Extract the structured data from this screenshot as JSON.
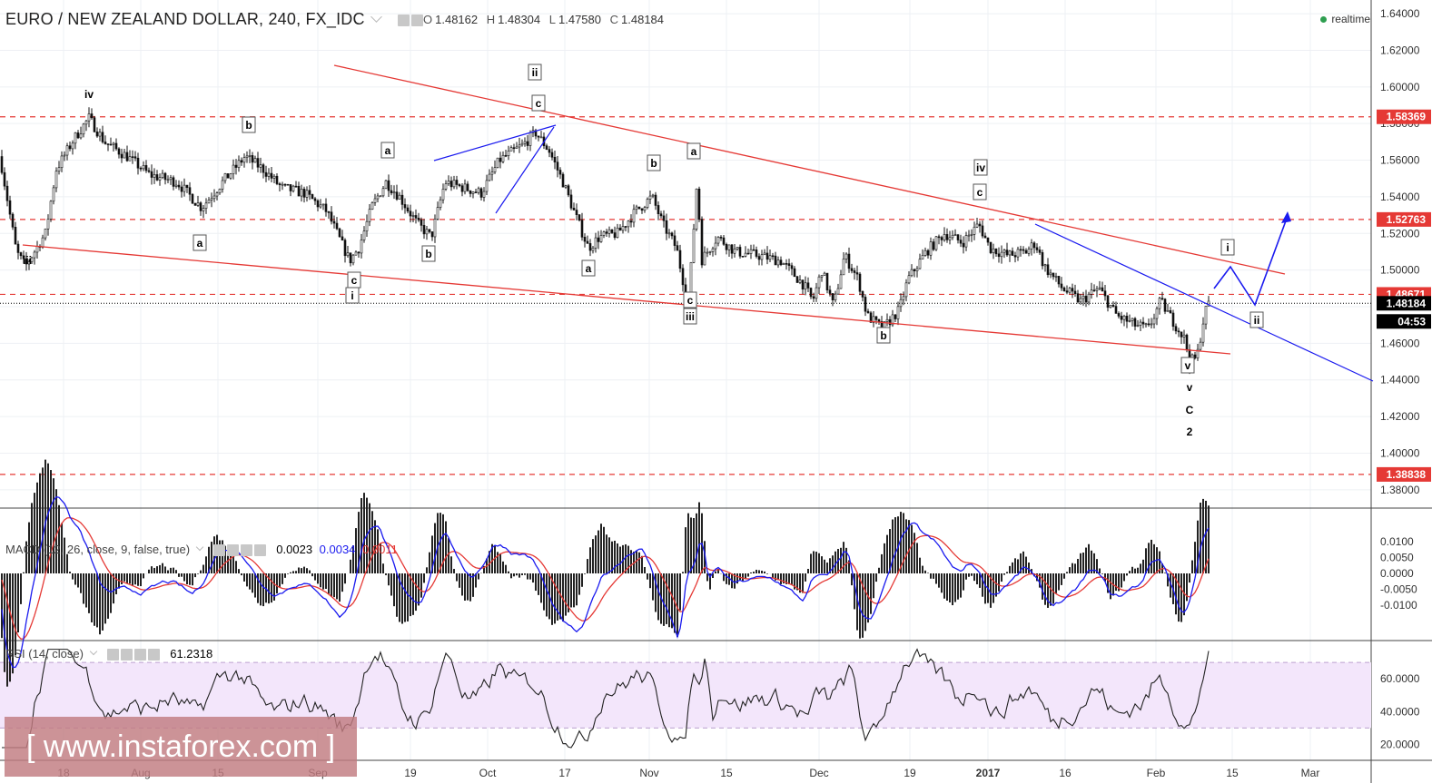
{
  "header": {
    "title": "EURO / NEW ZEALAND DOLLAR, 240, FX_IDC",
    "open_label": "O",
    "open": "1.48162",
    "high_label": "H",
    "high": "1.48304",
    "low_label": "L",
    "low": "1.47580",
    "close_label": "C",
    "close": "1.48184",
    "realtime": "realtime"
  },
  "price_scale": [
    "1.64000",
    "1.62000",
    "1.60000",
    "1.58000",
    "1.56000",
    "1.54000",
    "1.52000",
    "1.50000",
    "1.48000",
    "1.46000",
    "1.44000",
    "1.42000",
    "1.40000",
    "1.38000"
  ],
  "price_tags": [
    {
      "label": "1.58369",
      "kind": "level"
    },
    {
      "label": "1.52763",
      "kind": "level"
    },
    {
      "label": "1.48671",
      "kind": "level"
    },
    {
      "label": "1.48184",
      "kind": "current"
    },
    {
      "label": "04:53",
      "kind": "timer"
    },
    {
      "label": "1.38838",
      "kind": "level"
    }
  ],
  "time_axis": [
    "18",
    "Aug",
    "15",
    "Sep",
    "19",
    "Oct",
    "17",
    "Nov",
    "15",
    "Dec",
    "19",
    "2017",
    "16",
    "Feb",
    "15",
    "Mar"
  ],
  "wave_labels": [
    "iv",
    "iii",
    "b",
    "a",
    "c",
    "i",
    "a",
    "b",
    "ii",
    "c",
    "a",
    "b",
    "a",
    "c",
    "iii",
    "iv",
    "c",
    "b",
    "i",
    "ii",
    "v",
    "v",
    "C",
    "2"
  ],
  "macd": {
    "label": "MACD (12, 26, close, 9, false, true)",
    "hist": "0.0023",
    "macd": "0.0034",
    "signal": "0.0011",
    "scale": [
      "0.0100",
      "0.0050",
      "0.0000",
      "-0.0050",
      "-0.0100"
    ]
  },
  "rsi": {
    "label": "RSI (14, close)",
    "value": "61.2318",
    "scale": [
      "60.0000",
      "40.0000",
      "20.0000"
    ]
  },
  "watermark": "[ www.instaforex.com ]",
  "colors": {
    "trendline": "#e53935",
    "wave_line": "#1a1aef",
    "signal": "#e53935",
    "rsi_band": "#f3e6fb",
    "current_price": "#000000"
  },
  "chart_data": {
    "type": "candlestick",
    "symbol": "EURO / NEW ZEALAND DOLLAR",
    "timeframe": "240",
    "ohlc_last": {
      "open": 1.48162,
      "high": 1.48304,
      "low": 1.4758,
      "close": 1.48184
    },
    "ylim": [
      1.37,
      1.645
    ],
    "levels": [
      1.58369,
      1.52763,
      1.48671,
      1.38838
    ],
    "current_price": 1.48184,
    "approx_path": [
      [
        0,
        1.562
      ],
      [
        18,
        1.51
      ],
      [
        28,
        1.502
      ],
      [
        50,
        1.52
      ],
      [
        62,
        1.555
      ],
      [
        82,
        1.572
      ],
      [
        98,
        1.583
      ],
      [
        115,
        1.57
      ],
      [
        140,
        1.562
      ],
      [
        165,
        1.552
      ],
      [
        195,
        1.548
      ],
      [
        222,
        1.534
      ],
      [
        245,
        1.548
      ],
      [
        270,
        1.562
      ],
      [
        290,
        1.555
      ],
      [
        310,
        1.545
      ],
      [
        335,
        1.542
      ],
      [
        360,
        1.532
      ],
      [
        385,
        1.505
      ],
      [
        395,
        1.512
      ],
      [
        410,
        1.535
      ],
      [
        425,
        1.548
      ],
      [
        440,
        1.54
      ],
      [
        460,
        1.525
      ],
      [
        475,
        1.518
      ],
      [
        490,
        1.548
      ],
      [
        510,
        1.545
      ],
      [
        530,
        1.542
      ],
      [
        550,
        1.56
      ],
      [
        575,
        1.568
      ],
      [
        590,
        1.575
      ],
      [
        605,
        1.565
      ],
      [
        620,
        1.548
      ],
      [
        632,
        1.532
      ],
      [
        648,
        1.512
      ],
      [
        660,
        1.518
      ],
      [
        680,
        1.52
      ],
      [
        700,
        1.532
      ],
      [
        718,
        1.54
      ],
      [
        730,
        1.525
      ],
      [
        745,
        1.512
      ],
      [
        758,
        1.48
      ],
      [
        768,
        1.552
      ],
      [
        772,
        1.505
      ],
      [
        790,
        1.518
      ],
      [
        810,
        1.51
      ],
      [
        835,
        1.508
      ],
      [
        860,
        1.505
      ],
      [
        885,
        1.492
      ],
      [
        895,
        1.483
      ],
      [
        905,
        1.5
      ],
      [
        918,
        1.48
      ],
      [
        930,
        1.508
      ],
      [
        945,
        1.495
      ],
      [
        955,
        1.475
      ],
      [
        972,
        1.468
      ],
      [
        990,
        1.478
      ],
      [
        1000,
        1.495
      ],
      [
        1020,
        1.51
      ],
      [
        1040,
        1.52
      ],
      [
        1060,
        1.515
      ],
      [
        1078,
        1.525
      ],
      [
        1090,
        1.512
      ],
      [
        1110,
        1.508
      ],
      [
        1130,
        1.51
      ],
      [
        1140,
        1.515
      ],
      [
        1150,
        1.502
      ],
      [
        1170,
        1.49
      ],
      [
        1190,
        1.483
      ],
      [
        1210,
        1.49
      ],
      [
        1230,
        1.475
      ],
      [
        1250,
        1.47
      ],
      [
        1265,
        1.468
      ],
      [
        1278,
        1.483
      ],
      [
        1292,
        1.472
      ],
      [
        1305,
        1.462
      ],
      [
        1310,
        1.45
      ],
      [
        1318,
        1.452
      ],
      [
        1325,
        1.472
      ],
      [
        1330,
        1.482
      ]
    ]
  }
}
